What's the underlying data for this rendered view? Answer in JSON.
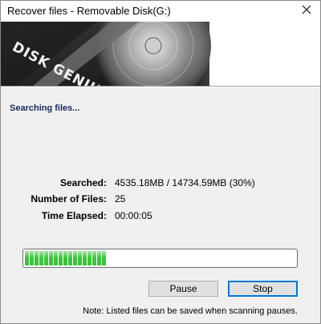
{
  "window": {
    "title": "Recover files - Removable Disk(G:)",
    "close_icon": "close-icon"
  },
  "banner": {
    "logo_text": "DISK GENIUS",
    "image": "hard-disk-platter-image"
  },
  "status": {
    "heading": "Searching files..."
  },
  "stats": {
    "searched_label": "Searched:",
    "searched_value": "4535.18MB / 14734.59MB (30%)",
    "files_label": "Number of Files:",
    "files_value": "25",
    "elapsed_label": "Time Elapsed:",
    "elapsed_value": "00:00:05"
  },
  "progress": {
    "percent": 30,
    "fill_color": "#3cc43c"
  },
  "buttons": {
    "pause_label": "Pause",
    "stop_label": "Stop"
  },
  "note": "Note: Listed files can be saved when scanning pauses.",
  "colors": {
    "heading": "#1a2a5a",
    "default_button_border": "#0078d7"
  }
}
